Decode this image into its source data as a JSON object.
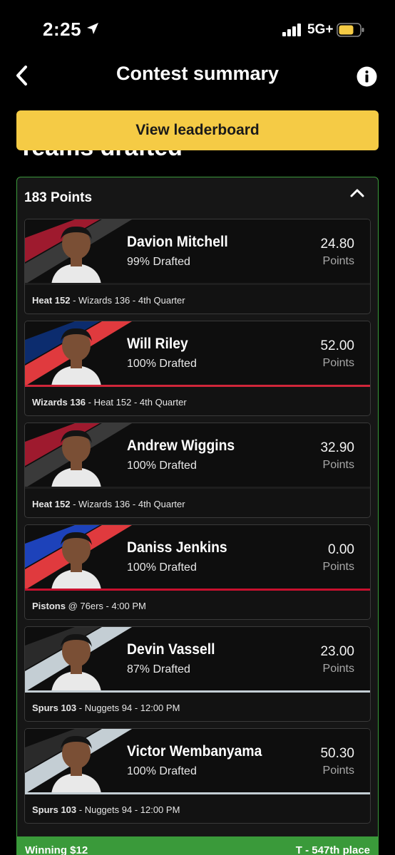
{
  "status": {
    "time": "2:25",
    "network": "5G+"
  },
  "nav": {
    "title": "Contest summary"
  },
  "leaderboard_button": "View leaderboard",
  "section_heading": "Teams drafted",
  "panel": {
    "total": "183 Points"
  },
  "players": [
    {
      "name": "Davion Mitchell",
      "drafted": "99% Drafted",
      "points": "24.80",
      "points_label": "Points",
      "team": "Heat 152",
      "game": " - Wizards 136 - 4th Quarter",
      "primary": "#9e1a2e",
      "secondary": "#3a3a3a",
      "stripe": "#1e1e1e"
    },
    {
      "name": "Will Riley",
      "drafted": "100% Drafted",
      "points": "52.00",
      "points_label": "Points",
      "team": "Wizards 136",
      "game": " - Heat 152 - 4th Quarter",
      "primary": "#0c2c6e",
      "secondary": "#e03a3e",
      "stripe": "#d0263a"
    },
    {
      "name": "Andrew Wiggins",
      "drafted": "100% Drafted",
      "points": "32.90",
      "points_label": "Points",
      "team": "Heat 152",
      "game": " - Wizards 136 - 4th Quarter",
      "primary": "#9e1a2e",
      "secondary": "#3a3a3a",
      "stripe": "#1e1e1e"
    },
    {
      "name": "Daniss Jenkins",
      "drafted": "100% Drafted",
      "points": "0.00",
      "points_label": "Points",
      "team": "Pistons",
      "game": " @ 76ers - 4:00 PM",
      "primary": "#1d42ba",
      "secondary": "#e03a3e",
      "stripe": "#c8102e"
    },
    {
      "name": "Devin Vassell",
      "drafted": "87% Drafted",
      "points": "23.00",
      "points_label": "Points",
      "team": "Spurs 103",
      "game": " - Nuggets 94 - 12:00 PM",
      "primary": "#2a2a2a",
      "secondary": "#c4ced4",
      "stripe": "#c4ced4"
    },
    {
      "name": "Victor Wembanyama",
      "drafted": "100% Drafted",
      "points": "50.30",
      "points_label": "Points",
      "team": "Spurs 103",
      "game": " - Nuggets 94 - 12:00 PM",
      "primary": "#2a2a2a",
      "secondary": "#c4ced4",
      "stripe": "#c4ced4"
    }
  ],
  "winning": {
    "left": "Winning $12",
    "right": "T - 547th place"
  },
  "colors": {
    "accent": "#f5cb45",
    "panel_border": "#3c9a3c",
    "win_bar": "#3a9a3a"
  }
}
